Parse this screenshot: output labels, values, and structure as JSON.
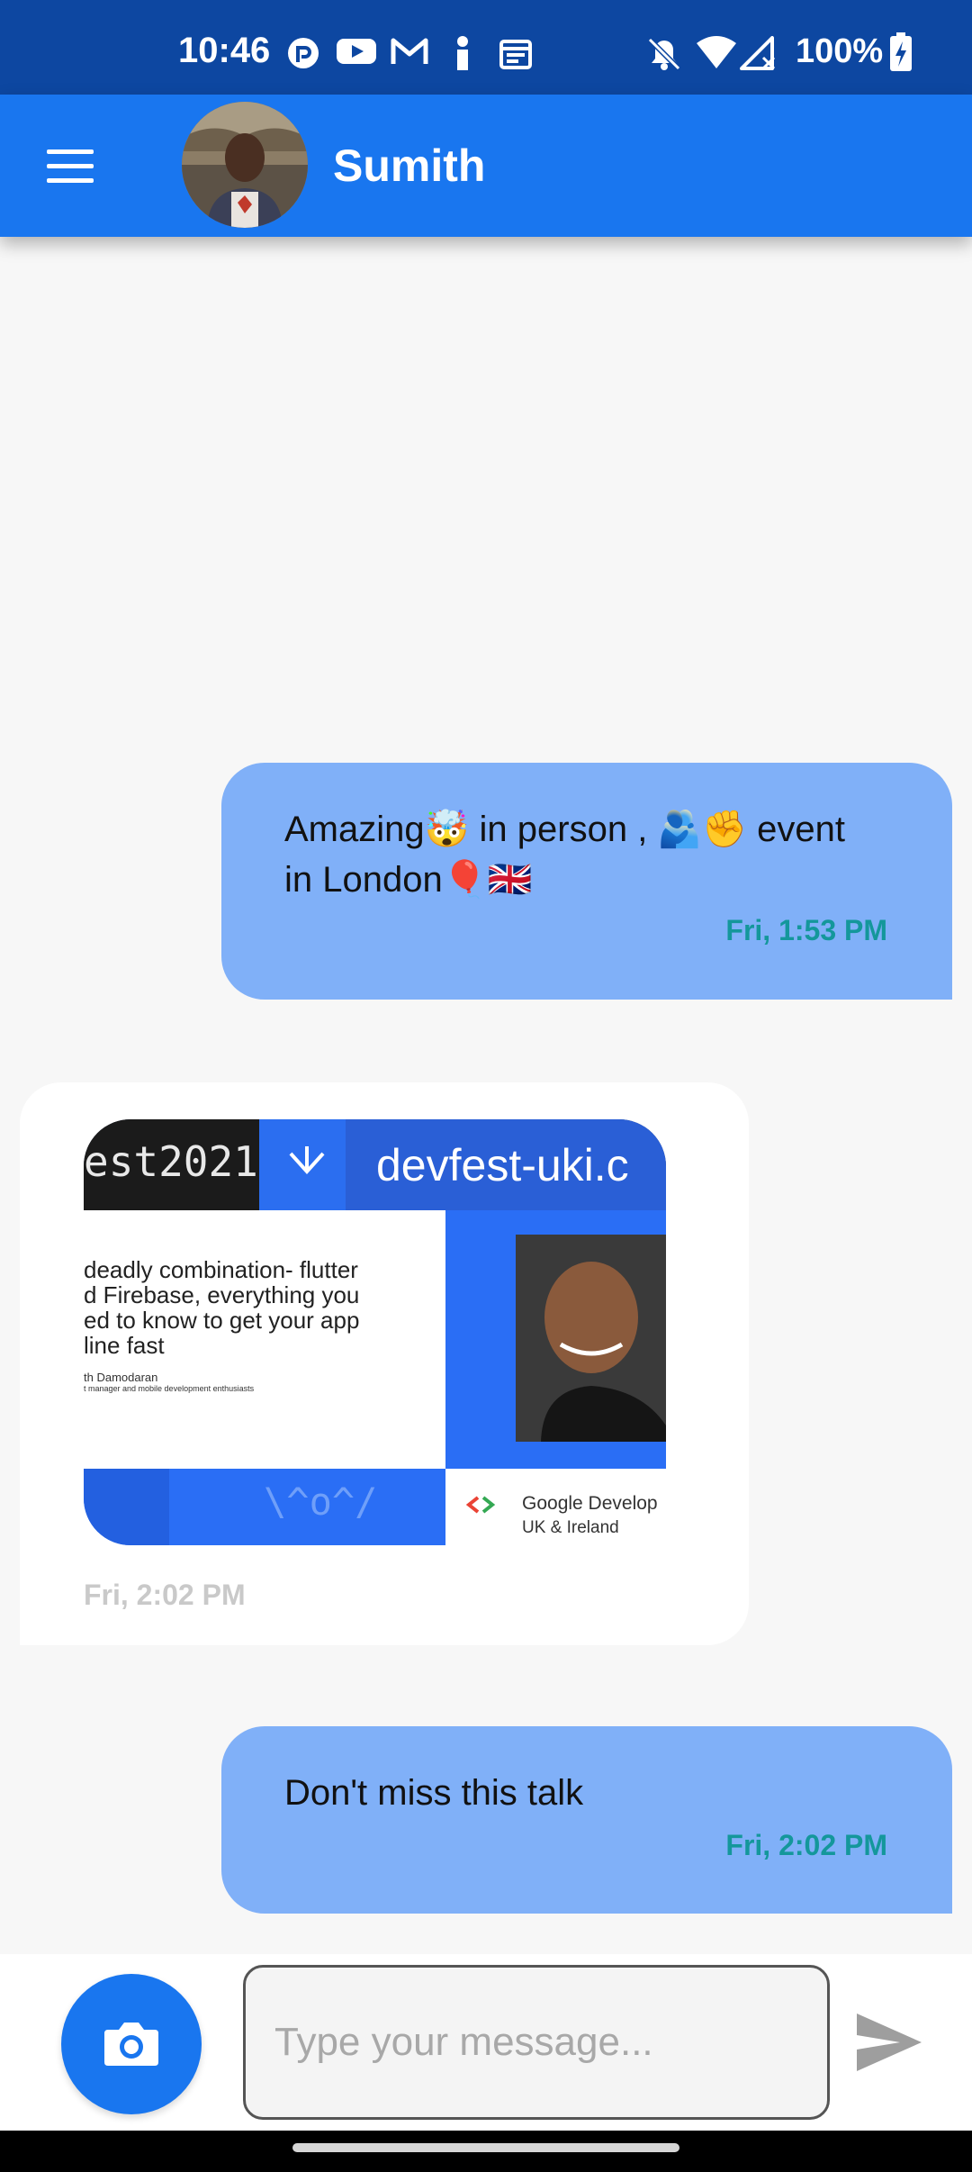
{
  "status_bar": {
    "time": "10:46",
    "battery": "100%",
    "left_icons": [
      "pocket-casts-icon",
      "youtube-icon",
      "gmail-icon",
      "info-icon",
      "calendar-icon"
    ],
    "right_icons": [
      "bell-off-icon",
      "wifi-icon",
      "no-signal-icon",
      "battery-charging-icon"
    ]
  },
  "app_bar": {
    "contact_name": "Sumith",
    "menu_icon": "hamburger-menu-icon",
    "color": "#1976ef"
  },
  "messages": [
    {
      "direction": "outgoing",
      "text_line1": "Amazing🤯 in person , 🫂✊ event",
      "text_line2": "in London🎈🇬🇧",
      "time": "Fri, 1:53 PM"
    },
    {
      "direction": "incoming",
      "type": "image",
      "time": "Fri, 2:02 PM",
      "slide": {
        "header_left": "est2021",
        "header_right": "devfest-uki.c",
        "talk_line1": "deadly combination- flutter",
        "talk_line2": "d Firebase, everything you",
        "talk_line3": "ed to know to get your app",
        "talk_line4": "line fast",
        "speaker": "th Damodaran",
        "speaker_role": "t manager and mobile development enthusiasts",
        "footer_binary": "\\^o^/",
        "brand_line1": "Google Develop",
        "brand_line2": "UK & Ireland"
      }
    },
    {
      "direction": "outgoing",
      "text": "Don't miss this talk",
      "time": "Fri, 2:02 PM"
    }
  ],
  "composer": {
    "placeholder": "Type your message...",
    "value": "",
    "camera_icon": "camera-icon",
    "send_icon": "send-icon"
  },
  "colors": {
    "status_bar": "#0d47a1",
    "outgoing_bubble": "#80b0f8",
    "timestamp_outgoing": "#14979b",
    "timestamp_incoming": "#c9c9c9"
  }
}
